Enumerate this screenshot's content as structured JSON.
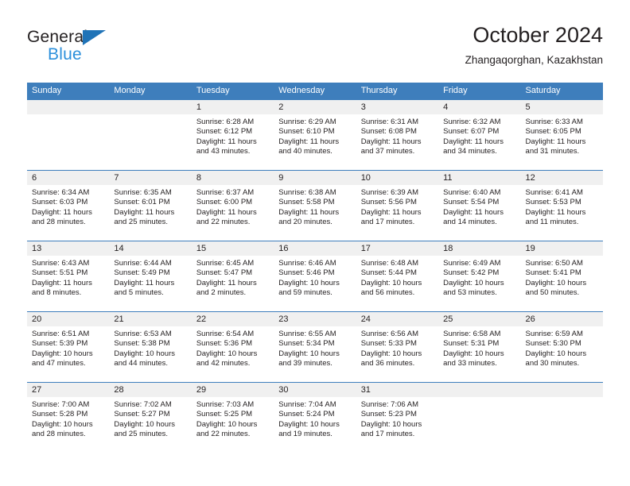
{
  "brand": {
    "name_line1": "General",
    "name_line2": "Blue",
    "triangle_color": "#1f73b7",
    "blue_text_color": "#2b8fdb"
  },
  "header": {
    "title": "October 2024",
    "subtitle": "Zhangaqorghan, Kazakhstan"
  },
  "theme": {
    "header_blue": "#3e7ebc",
    "daynum_bg": "#f0f0f0",
    "text": "#231f20"
  },
  "weekdays": [
    "Sunday",
    "Monday",
    "Tuesday",
    "Wednesday",
    "Thursday",
    "Friday",
    "Saturday"
  ],
  "weeks": [
    [
      {
        "day": "",
        "sunrise": "",
        "sunset": "",
        "daylight1": "",
        "daylight2": ""
      },
      {
        "day": "",
        "sunrise": "",
        "sunset": "",
        "daylight1": "",
        "daylight2": ""
      },
      {
        "day": "1",
        "sunrise": "Sunrise: 6:28 AM",
        "sunset": "Sunset: 6:12 PM",
        "daylight1": "Daylight: 11 hours",
        "daylight2": "and 43 minutes."
      },
      {
        "day": "2",
        "sunrise": "Sunrise: 6:29 AM",
        "sunset": "Sunset: 6:10 PM",
        "daylight1": "Daylight: 11 hours",
        "daylight2": "and 40 minutes."
      },
      {
        "day": "3",
        "sunrise": "Sunrise: 6:31 AM",
        "sunset": "Sunset: 6:08 PM",
        "daylight1": "Daylight: 11 hours",
        "daylight2": "and 37 minutes."
      },
      {
        "day": "4",
        "sunrise": "Sunrise: 6:32 AM",
        "sunset": "Sunset: 6:07 PM",
        "daylight1": "Daylight: 11 hours",
        "daylight2": "and 34 minutes."
      },
      {
        "day": "5",
        "sunrise": "Sunrise: 6:33 AM",
        "sunset": "Sunset: 6:05 PM",
        "daylight1": "Daylight: 11 hours",
        "daylight2": "and 31 minutes."
      }
    ],
    [
      {
        "day": "6",
        "sunrise": "Sunrise: 6:34 AM",
        "sunset": "Sunset: 6:03 PM",
        "daylight1": "Daylight: 11 hours",
        "daylight2": "and 28 minutes."
      },
      {
        "day": "7",
        "sunrise": "Sunrise: 6:35 AM",
        "sunset": "Sunset: 6:01 PM",
        "daylight1": "Daylight: 11 hours",
        "daylight2": "and 25 minutes."
      },
      {
        "day": "8",
        "sunrise": "Sunrise: 6:37 AM",
        "sunset": "Sunset: 6:00 PM",
        "daylight1": "Daylight: 11 hours",
        "daylight2": "and 22 minutes."
      },
      {
        "day": "9",
        "sunrise": "Sunrise: 6:38 AM",
        "sunset": "Sunset: 5:58 PM",
        "daylight1": "Daylight: 11 hours",
        "daylight2": "and 20 minutes."
      },
      {
        "day": "10",
        "sunrise": "Sunrise: 6:39 AM",
        "sunset": "Sunset: 5:56 PM",
        "daylight1": "Daylight: 11 hours",
        "daylight2": "and 17 minutes."
      },
      {
        "day": "11",
        "sunrise": "Sunrise: 6:40 AM",
        "sunset": "Sunset: 5:54 PM",
        "daylight1": "Daylight: 11 hours",
        "daylight2": "and 14 minutes."
      },
      {
        "day": "12",
        "sunrise": "Sunrise: 6:41 AM",
        "sunset": "Sunset: 5:53 PM",
        "daylight1": "Daylight: 11 hours",
        "daylight2": "and 11 minutes."
      }
    ],
    [
      {
        "day": "13",
        "sunrise": "Sunrise: 6:43 AM",
        "sunset": "Sunset: 5:51 PM",
        "daylight1": "Daylight: 11 hours",
        "daylight2": "and 8 minutes."
      },
      {
        "day": "14",
        "sunrise": "Sunrise: 6:44 AM",
        "sunset": "Sunset: 5:49 PM",
        "daylight1": "Daylight: 11 hours",
        "daylight2": "and 5 minutes."
      },
      {
        "day": "15",
        "sunrise": "Sunrise: 6:45 AM",
        "sunset": "Sunset: 5:47 PM",
        "daylight1": "Daylight: 11 hours",
        "daylight2": "and 2 minutes."
      },
      {
        "day": "16",
        "sunrise": "Sunrise: 6:46 AM",
        "sunset": "Sunset: 5:46 PM",
        "daylight1": "Daylight: 10 hours",
        "daylight2": "and 59 minutes."
      },
      {
        "day": "17",
        "sunrise": "Sunrise: 6:48 AM",
        "sunset": "Sunset: 5:44 PM",
        "daylight1": "Daylight: 10 hours",
        "daylight2": "and 56 minutes."
      },
      {
        "day": "18",
        "sunrise": "Sunrise: 6:49 AM",
        "sunset": "Sunset: 5:42 PM",
        "daylight1": "Daylight: 10 hours",
        "daylight2": "and 53 minutes."
      },
      {
        "day": "19",
        "sunrise": "Sunrise: 6:50 AM",
        "sunset": "Sunset: 5:41 PM",
        "daylight1": "Daylight: 10 hours",
        "daylight2": "and 50 minutes."
      }
    ],
    [
      {
        "day": "20",
        "sunrise": "Sunrise: 6:51 AM",
        "sunset": "Sunset: 5:39 PM",
        "daylight1": "Daylight: 10 hours",
        "daylight2": "and 47 minutes."
      },
      {
        "day": "21",
        "sunrise": "Sunrise: 6:53 AM",
        "sunset": "Sunset: 5:38 PM",
        "daylight1": "Daylight: 10 hours",
        "daylight2": "and 44 minutes."
      },
      {
        "day": "22",
        "sunrise": "Sunrise: 6:54 AM",
        "sunset": "Sunset: 5:36 PM",
        "daylight1": "Daylight: 10 hours",
        "daylight2": "and 42 minutes."
      },
      {
        "day": "23",
        "sunrise": "Sunrise: 6:55 AM",
        "sunset": "Sunset: 5:34 PM",
        "daylight1": "Daylight: 10 hours",
        "daylight2": "and 39 minutes."
      },
      {
        "day": "24",
        "sunrise": "Sunrise: 6:56 AM",
        "sunset": "Sunset: 5:33 PM",
        "daylight1": "Daylight: 10 hours",
        "daylight2": "and 36 minutes."
      },
      {
        "day": "25",
        "sunrise": "Sunrise: 6:58 AM",
        "sunset": "Sunset: 5:31 PM",
        "daylight1": "Daylight: 10 hours",
        "daylight2": "and 33 minutes."
      },
      {
        "day": "26",
        "sunrise": "Sunrise: 6:59 AM",
        "sunset": "Sunset: 5:30 PM",
        "daylight1": "Daylight: 10 hours",
        "daylight2": "and 30 minutes."
      }
    ],
    [
      {
        "day": "27",
        "sunrise": "Sunrise: 7:00 AM",
        "sunset": "Sunset: 5:28 PM",
        "daylight1": "Daylight: 10 hours",
        "daylight2": "and 28 minutes."
      },
      {
        "day": "28",
        "sunrise": "Sunrise: 7:02 AM",
        "sunset": "Sunset: 5:27 PM",
        "daylight1": "Daylight: 10 hours",
        "daylight2": "and 25 minutes."
      },
      {
        "day": "29",
        "sunrise": "Sunrise: 7:03 AM",
        "sunset": "Sunset: 5:25 PM",
        "daylight1": "Daylight: 10 hours",
        "daylight2": "and 22 minutes."
      },
      {
        "day": "30",
        "sunrise": "Sunrise: 7:04 AM",
        "sunset": "Sunset: 5:24 PM",
        "daylight1": "Daylight: 10 hours",
        "daylight2": "and 19 minutes."
      },
      {
        "day": "31",
        "sunrise": "Sunrise: 7:06 AM",
        "sunset": "Sunset: 5:23 PM",
        "daylight1": "Daylight: 10 hours",
        "daylight2": "and 17 minutes."
      },
      {
        "day": "",
        "sunrise": "",
        "sunset": "",
        "daylight1": "",
        "daylight2": ""
      },
      {
        "day": "",
        "sunrise": "",
        "sunset": "",
        "daylight1": "",
        "daylight2": ""
      }
    ]
  ]
}
